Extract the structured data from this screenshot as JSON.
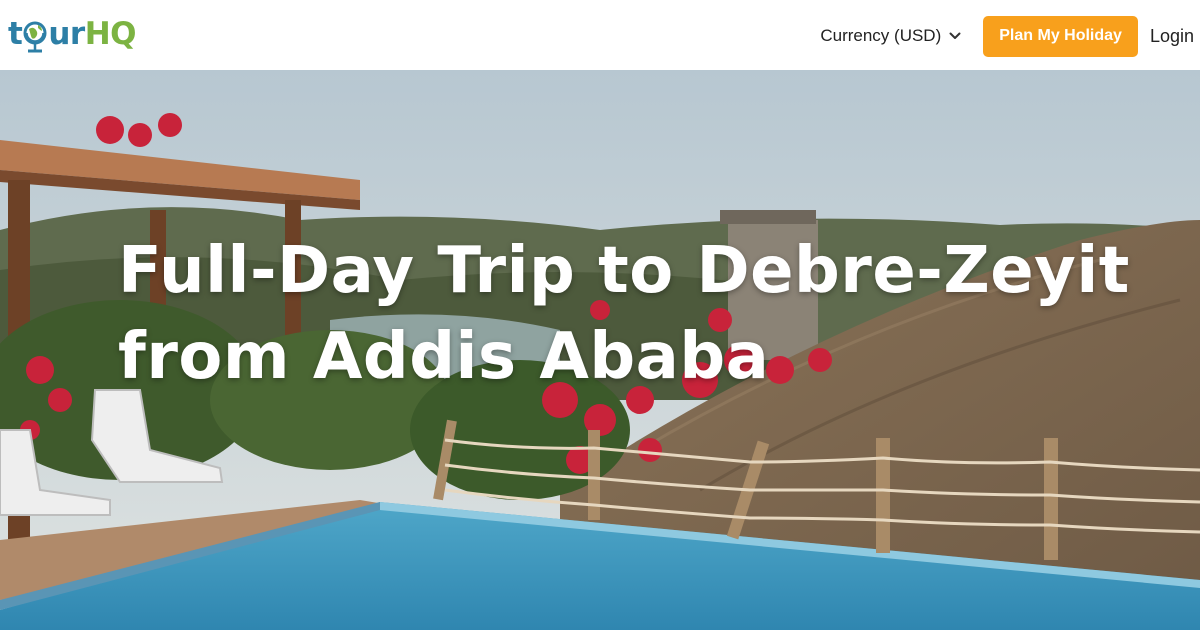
{
  "brand": {
    "logo_prefix": "t",
    "logo_middle": "ur",
    "logo_suffix": "HQ",
    "colors": {
      "blue": "#2d7fa6",
      "green": "#7cb342"
    }
  },
  "nav": {
    "currency_label": "Currency (USD)",
    "currency_icon": "chevron-down-icon",
    "plan_button_label": "Plan My Holiday",
    "plan_button_color": "#f8a01c",
    "login_label": "Login"
  },
  "hero": {
    "title_line1": "Full-Day Trip to Debre-Zeyit",
    "title_line2": "from Addis Ababa"
  }
}
